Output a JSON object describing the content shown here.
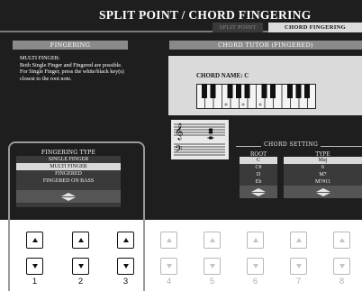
{
  "header": {
    "title": "SPLIT POINT / CHORD FINGERING",
    "tabs": [
      {
        "label": "SPLIT POINT",
        "active": false
      },
      {
        "label": "CHORD FINGERING",
        "active": true
      }
    ]
  },
  "left_panel": {
    "header": "FINGERING",
    "description": "MULTI FINGER:\nBoth Single Finger and Fingered are possible. For Single Finger, press the white/black key(s) closest to the root note."
  },
  "right_panel": {
    "header": "CHORD TUTOR (FINGERED)",
    "chord_name_label": "CHORD NAME: C"
  },
  "chord_setting": {
    "title": "CHORD SETTING",
    "root_header": "ROOT",
    "type_header": "TYPE",
    "root_items": [
      "C",
      "C#",
      "D",
      "Eb"
    ],
    "root_selected": 0,
    "type_items": [
      "Maj",
      "6",
      "M7",
      "M7#11"
    ],
    "type_selected": 0
  },
  "fingering_type": {
    "header": "FINGERING TYPE",
    "items": [
      "SINGLE FINGER",
      "MULTI FINGER",
      "FINGERED",
      "FINGERED ON BASS"
    ],
    "selected": 1
  },
  "buttons": {
    "numbers": [
      "1",
      "2",
      "3",
      "4",
      "5",
      "6",
      "7",
      "8"
    ],
    "active_count": 3
  },
  "colors": {
    "screen_bg": "#1e1e1e",
    "header_bar": "#8a8a8a",
    "panel_bg": "#dadada",
    "highlight_border": "#9a9a9a"
  }
}
